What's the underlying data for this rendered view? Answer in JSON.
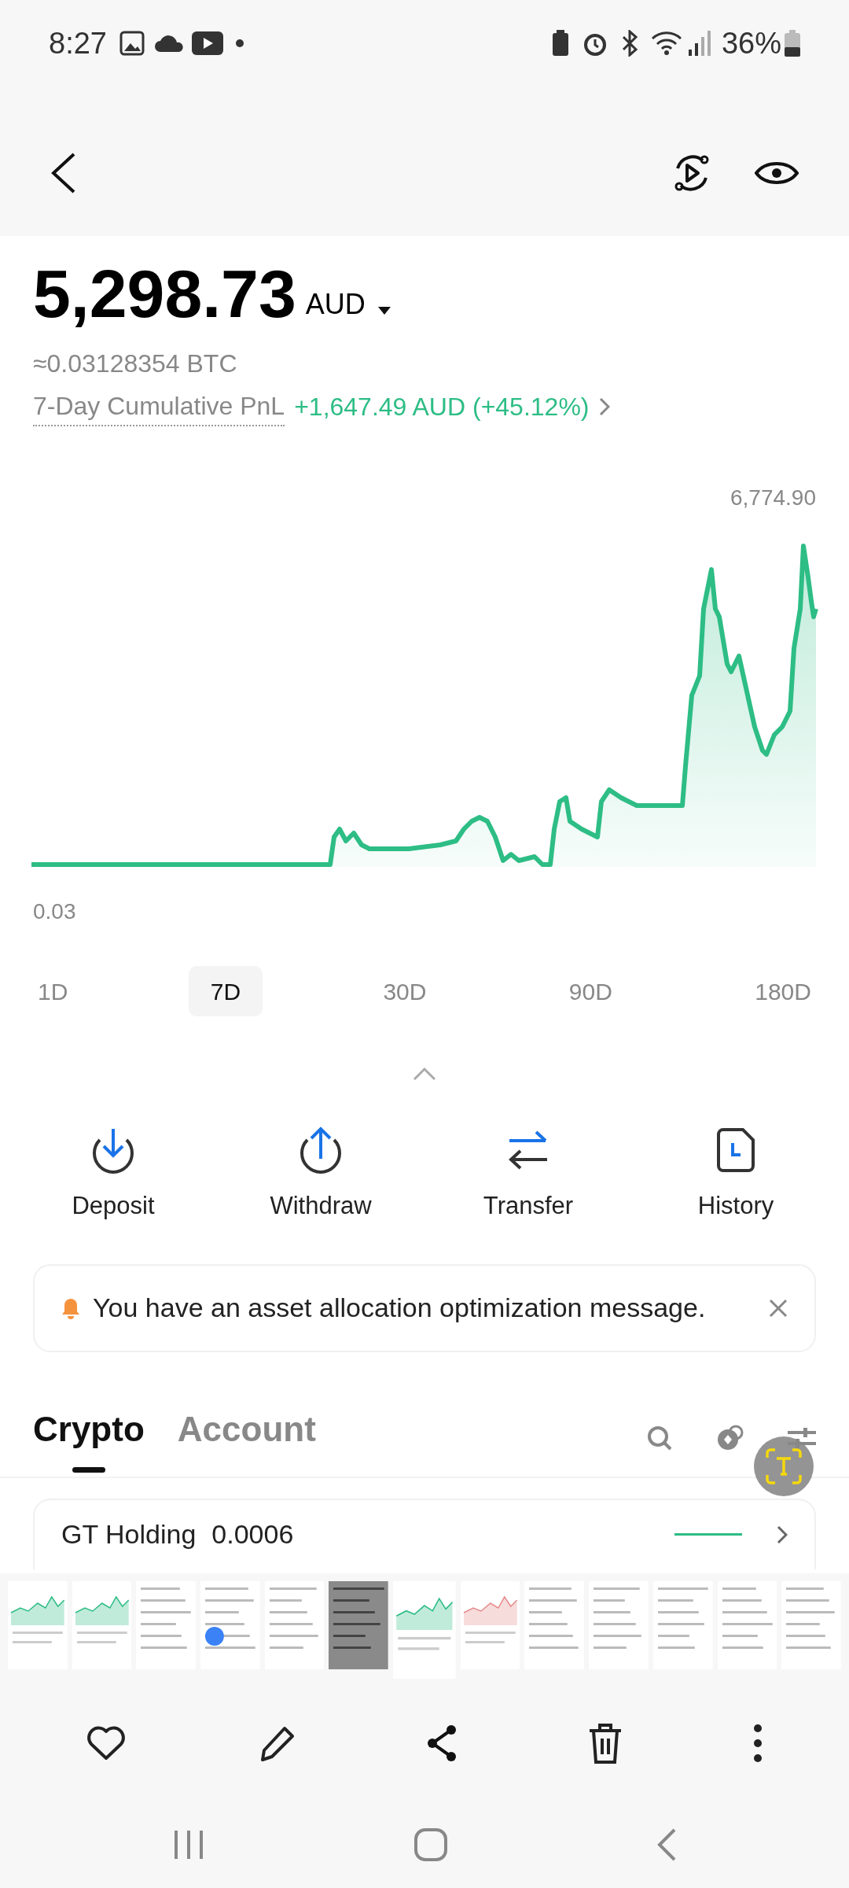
{
  "status_bar": {
    "time": "8:27",
    "battery": "36%"
  },
  "balance": {
    "amount": "5,298.73",
    "currency": "AUD",
    "btc": "≈0.03128354 BTC",
    "pnl_label": "7-Day Cumulative PnL",
    "pnl_value": "+1,647.49 AUD (+45.12%)"
  },
  "chart": {
    "max_label": "6,774.90",
    "min_label": "0.03"
  },
  "periods": [
    {
      "label": "1D",
      "selected": false
    },
    {
      "label": "7D",
      "selected": true
    },
    {
      "label": "30D",
      "selected": false
    },
    {
      "label": "90D",
      "selected": false
    },
    {
      "label": "180D",
      "selected": false
    }
  ],
  "actions": [
    {
      "label": "Deposit",
      "kind": "deposit"
    },
    {
      "label": "Withdraw",
      "kind": "withdraw"
    },
    {
      "label": "Transfer",
      "kind": "transfer"
    },
    {
      "label": "History",
      "kind": "history"
    }
  ],
  "notice": "You have an asset allocation optimization message.",
  "asset_tabs": [
    {
      "label": "Crypto",
      "selected": true
    },
    {
      "label": "Account",
      "selected": false
    }
  ],
  "holding": {
    "label": "GT Holding",
    "value": "0.0006"
  },
  "thumbnails": [
    {
      "selected": false
    },
    {
      "selected": false
    },
    {
      "selected": false
    },
    {
      "selected": false
    },
    {
      "selected": false
    },
    {
      "selected": false
    },
    {
      "selected": true
    },
    {
      "selected": false
    },
    {
      "selected": false
    },
    {
      "selected": false
    },
    {
      "selected": false
    },
    {
      "selected": false
    },
    {
      "selected": false
    }
  ]
}
